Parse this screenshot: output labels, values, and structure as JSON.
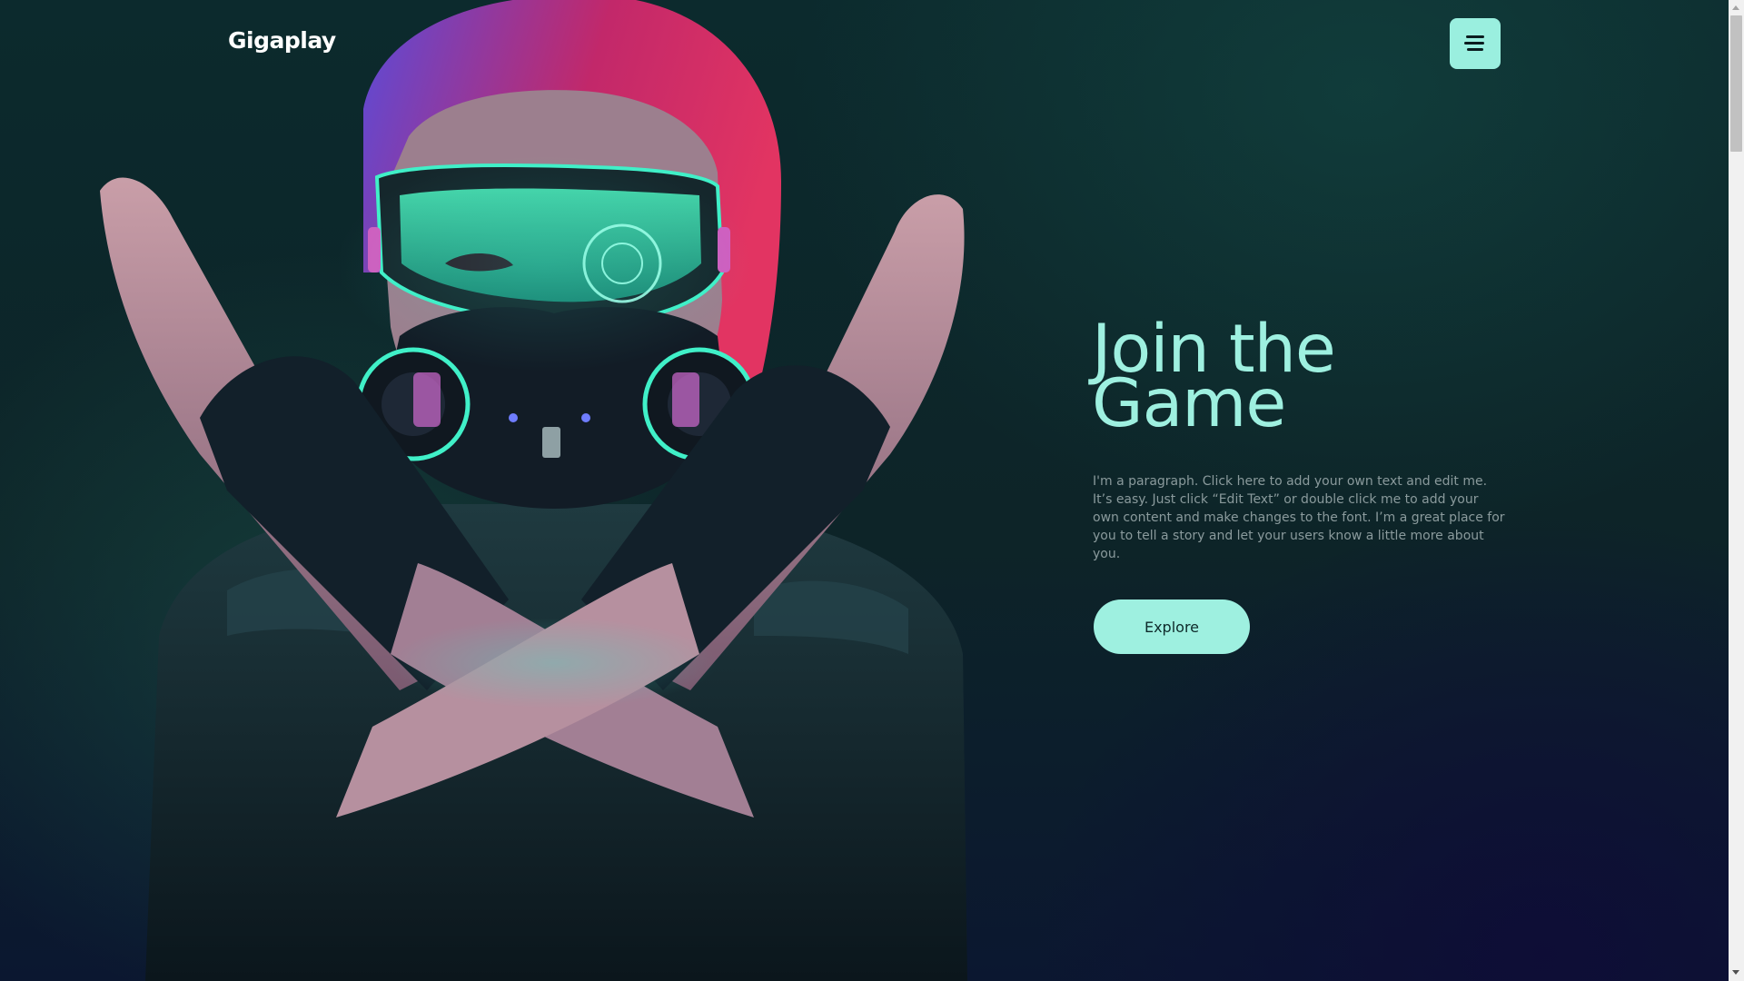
{
  "header": {
    "logo": "Gigaplay",
    "menu_icon": "hamburger-menu-icon"
  },
  "hero": {
    "title_line1": "Join the",
    "title_line2": "Game",
    "paragraph": "I'm a paragraph. Click here to add your own text and edit me. It’s easy. Just click “Edit Text” or double click me to add your own content and make changes to the font. I’m a great place for you to tell a story and let your users know a little more about you.",
    "button_label": "Explore",
    "image": "cyberpunk-woman-gas-mask-crossed-arms"
  },
  "colors": {
    "accent": "#9ef0e0",
    "background": "#0c2a2d",
    "text_muted": "#8a9a9c",
    "logo": "#ffffff"
  }
}
